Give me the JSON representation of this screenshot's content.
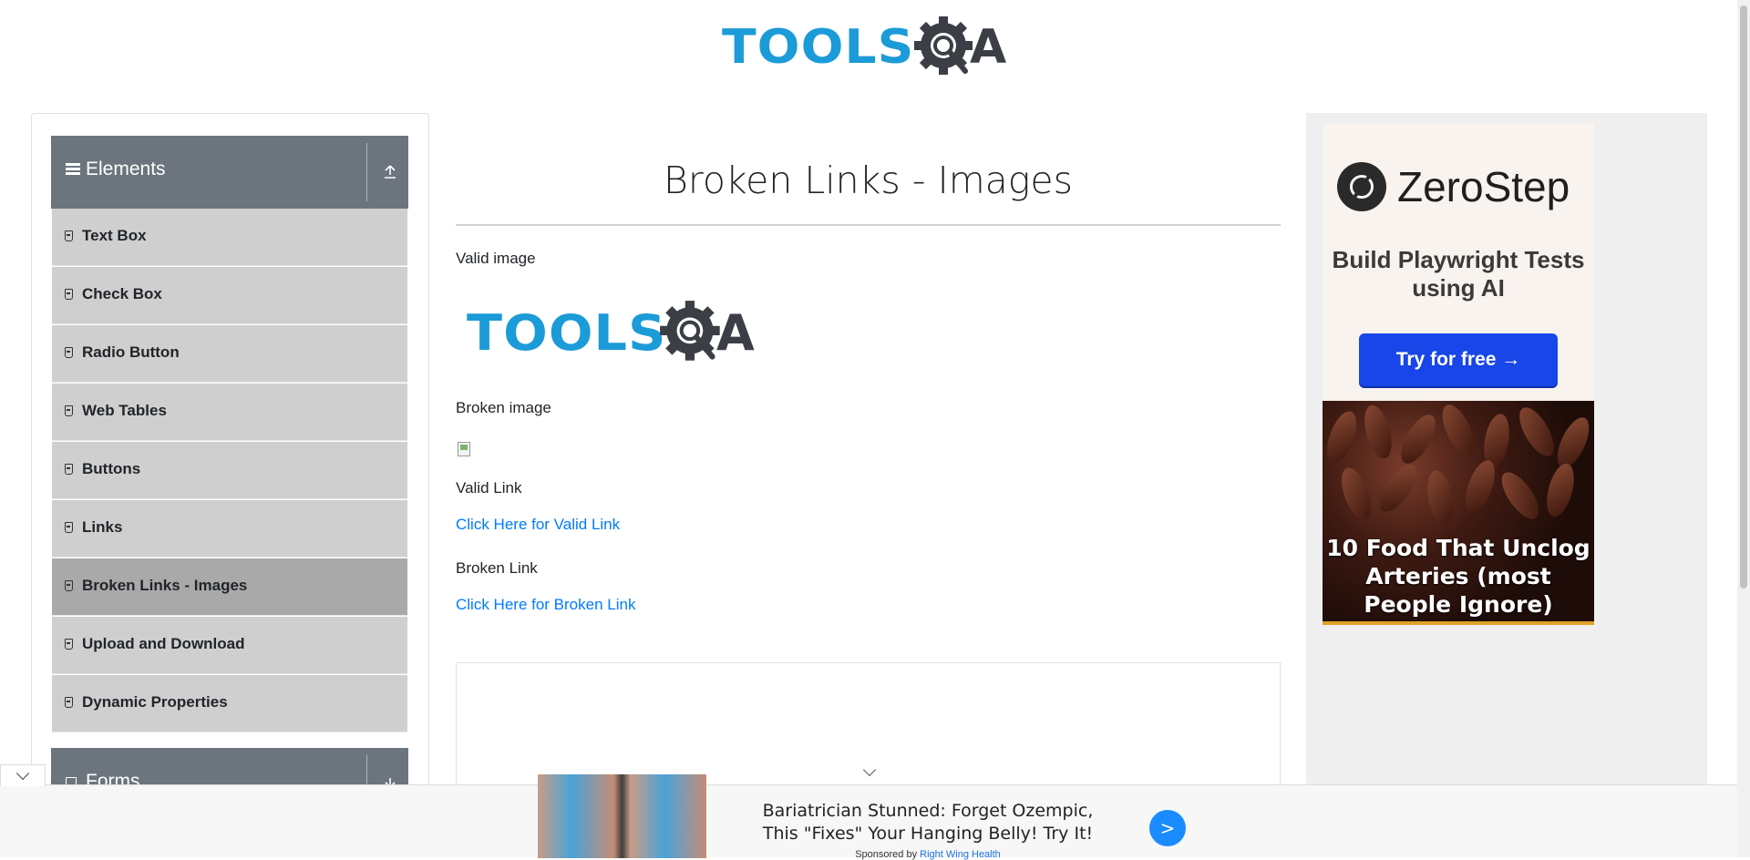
{
  "header": {
    "logo_text": "TOOLS",
    "logo_suffix": "A"
  },
  "sidebar": {
    "group_elements": "Elements",
    "items": [
      {
        "label": "Text Box"
      },
      {
        "label": "Check Box"
      },
      {
        "label": "Radio Button"
      },
      {
        "label": "Web Tables"
      },
      {
        "label": "Buttons"
      },
      {
        "label": "Links"
      },
      {
        "label": "Broken Links - Images",
        "active": true
      },
      {
        "label": "Upload and Download"
      },
      {
        "label": "Dynamic Properties"
      }
    ],
    "group_forms": "Forms"
  },
  "main": {
    "title": "Broken Links - Images",
    "valid_image_label": "Valid image",
    "broken_image_label": "Broken image",
    "valid_link_label": "Valid Link",
    "valid_link_text": "Click Here for Valid Link",
    "broken_link_label": "Broken Link",
    "broken_link_text": "Click Here for Broken Link"
  },
  "right_ad": {
    "brand": "ZeroStep",
    "tagline": "Build Playwright Tests using AI",
    "cta": "Try for free →",
    "food_caption": "10 Food That Unclog Arteries (most People Ignore)"
  },
  "bottom_ad": {
    "headline": "Bariatrician Stunned: Forget Ozempic, This \"Fixes\" Your Hanging Belly! Try It!",
    "sponsored_prefix": "Sponsored by ",
    "sponsor": "Right Wing Health",
    "go_label": ">"
  },
  "colors": {
    "brand_blue": "#1b9bd7",
    "sidebar_header": "#6c757d",
    "menu_item": "#cfcfcf",
    "menu_item_active": "#a9a9a9",
    "link": "#007bff",
    "cta_blue": "#1946e8"
  },
  "icons": {
    "elements_group": "hamburger-icon",
    "elements_toggle": "upload-arrow-icon",
    "menu_item": "html5-shield-icon",
    "bottom_collapse": "chevron-down-icon"
  }
}
